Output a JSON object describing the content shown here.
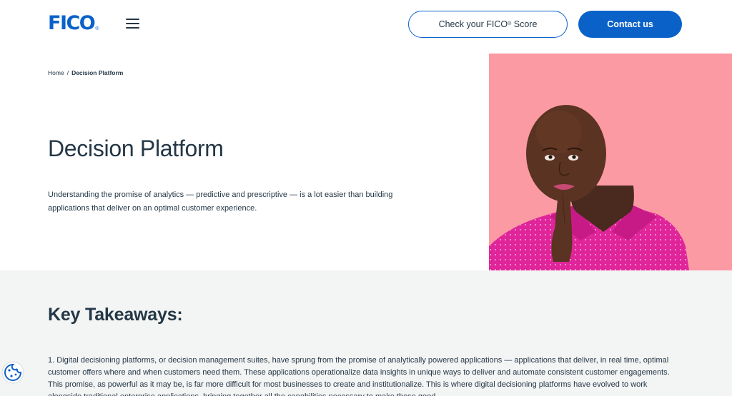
{
  "header": {
    "logo_text": "FICO",
    "logo_reg": "®",
    "check_score_label": "Check your FICO",
    "check_score_reg": "®",
    "check_score_suffix": " Score",
    "contact_label": "Contact us"
  },
  "breadcrumb": {
    "home": "Home",
    "separator": "/",
    "current": "Decision Platform"
  },
  "hero": {
    "title": "Decision Platform",
    "description": "Understanding the promise of analytics — predictive and prescriptive — is a lot easier than building applications that deliver on an optimal customer experience."
  },
  "takeaways": {
    "title": "Key Takeaways:",
    "body": "1. Digital decisioning platforms, or decision management suites, have sprung from the promise of analytically powered applications — applications that deliver, in real time, optimal customer offers where and when customers need them. These applications operationalize data insights in unique ways to deliver and automate consistent customer engagements. This promise, as powerful as it may be, is far more difficult for most businesses to create and institutionalize. This is where digital decisioning platforms have evolved to work alongside traditional enterprise applications, bringing together all the capabilities necessary to make those good"
  },
  "colors": {
    "brand_blue": "#0a62c9",
    "text_dark": "#243746",
    "hero_pink": "#fc9aa4",
    "band_gray": "#f3f4f4"
  },
  "icons": [
    "menu-icon",
    "cookie-icon"
  ]
}
